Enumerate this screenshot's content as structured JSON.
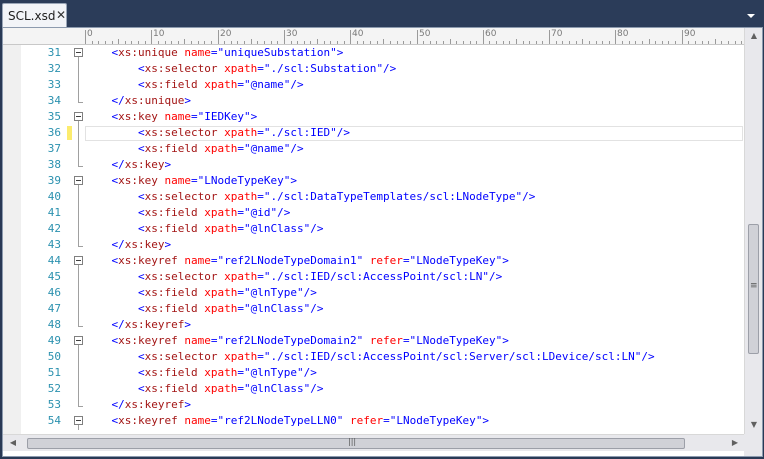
{
  "tab": {
    "title": "SCL.xsd",
    "close_glyph": "✕"
  },
  "ruler": {
    "labels": [
      "0",
      "10",
      "20",
      "30",
      "40",
      "50",
      "60",
      "70",
      "80",
      "90"
    ]
  },
  "scrollbar": {
    "up": "▲",
    "down": "▼",
    "left": "◀",
    "right": "▶",
    "thumb_grip": "≡",
    "hthumb_grip": "|||"
  },
  "editor": {
    "current_line": 36,
    "lines": [
      {
        "num": "31",
        "tokens": [
          [
            "i",
            "    "
          ],
          [
            "b",
            "<"
          ],
          [
            "t",
            "xs:unique"
          ],
          [
            "s",
            " "
          ],
          [
            "a",
            "name"
          ],
          [
            "b",
            "=\""
          ],
          [
            "v",
            "uniqueSubstation"
          ],
          [
            "b",
            "\">"
          ]
        ]
      },
      {
        "num": "32",
        "tokens": [
          [
            "i",
            "        "
          ],
          [
            "b",
            "<"
          ],
          [
            "t",
            "xs:selector"
          ],
          [
            "s",
            " "
          ],
          [
            "a",
            "xpath"
          ],
          [
            "b",
            "=\""
          ],
          [
            "v",
            "./scl:Substation"
          ],
          [
            "b",
            "\"/>"
          ]
        ]
      },
      {
        "num": "33",
        "tokens": [
          [
            "i",
            "        "
          ],
          [
            "b",
            "<"
          ],
          [
            "t",
            "xs:field"
          ],
          [
            "s",
            " "
          ],
          [
            "a",
            "xpath"
          ],
          [
            "b",
            "=\""
          ],
          [
            "v",
            "@name"
          ],
          [
            "b",
            "\"/>"
          ]
        ]
      },
      {
        "num": "34",
        "tokens": [
          [
            "i",
            "    "
          ],
          [
            "b",
            "</"
          ],
          [
            "t",
            "xs:unique"
          ],
          [
            "b",
            ">"
          ]
        ]
      },
      {
        "num": "35",
        "tokens": [
          [
            "i",
            "    "
          ],
          [
            "b",
            "<"
          ],
          [
            "t",
            "xs:key"
          ],
          [
            "s",
            " "
          ],
          [
            "a",
            "name"
          ],
          [
            "b",
            "=\""
          ],
          [
            "v",
            "IEDKey"
          ],
          [
            "b",
            "\">"
          ]
        ]
      },
      {
        "num": "36",
        "tokens": [
          [
            "i",
            "        "
          ],
          [
            "b",
            "<"
          ],
          [
            "t",
            "xs:selector"
          ],
          [
            "s",
            " "
          ],
          [
            "a",
            "xpath"
          ],
          [
            "b",
            "=\""
          ],
          [
            "v",
            "./scl:IED"
          ],
          [
            "b",
            "\"/>"
          ]
        ]
      },
      {
        "num": "37",
        "tokens": [
          [
            "i",
            "        "
          ],
          [
            "b",
            "<"
          ],
          [
            "t",
            "xs:field"
          ],
          [
            "s",
            " "
          ],
          [
            "a",
            "xpath"
          ],
          [
            "b",
            "=\""
          ],
          [
            "v",
            "@name"
          ],
          [
            "b",
            "\"/>"
          ]
        ]
      },
      {
        "num": "38",
        "tokens": [
          [
            "i",
            "    "
          ],
          [
            "b",
            "</"
          ],
          [
            "t",
            "xs:key"
          ],
          [
            "b",
            ">"
          ]
        ]
      },
      {
        "num": "39",
        "tokens": [
          [
            "i",
            "    "
          ],
          [
            "b",
            "<"
          ],
          [
            "t",
            "xs:key"
          ],
          [
            "s",
            " "
          ],
          [
            "a",
            "name"
          ],
          [
            "b",
            "=\""
          ],
          [
            "v",
            "LNodeTypeKey"
          ],
          [
            "b",
            "\">"
          ]
        ]
      },
      {
        "num": "40",
        "tokens": [
          [
            "i",
            "        "
          ],
          [
            "b",
            "<"
          ],
          [
            "t",
            "xs:selector"
          ],
          [
            "s",
            " "
          ],
          [
            "a",
            "xpath"
          ],
          [
            "b",
            "=\""
          ],
          [
            "v",
            "./scl:DataTypeTemplates/scl:LNodeType"
          ],
          [
            "b",
            "\"/>"
          ]
        ]
      },
      {
        "num": "41",
        "tokens": [
          [
            "i",
            "        "
          ],
          [
            "b",
            "<"
          ],
          [
            "t",
            "xs:field"
          ],
          [
            "s",
            " "
          ],
          [
            "a",
            "xpath"
          ],
          [
            "b",
            "=\""
          ],
          [
            "v",
            "@id"
          ],
          [
            "b",
            "\"/>"
          ]
        ]
      },
      {
        "num": "42",
        "tokens": [
          [
            "i",
            "        "
          ],
          [
            "b",
            "<"
          ],
          [
            "t",
            "xs:field"
          ],
          [
            "s",
            " "
          ],
          [
            "a",
            "xpath"
          ],
          [
            "b",
            "=\""
          ],
          [
            "v",
            "@lnClass"
          ],
          [
            "b",
            "\"/>"
          ]
        ]
      },
      {
        "num": "43",
        "tokens": [
          [
            "i",
            "    "
          ],
          [
            "b",
            "</"
          ],
          [
            "t",
            "xs:key"
          ],
          [
            "b",
            ">"
          ]
        ]
      },
      {
        "num": "44",
        "tokens": [
          [
            "i",
            "    "
          ],
          [
            "b",
            "<"
          ],
          [
            "t",
            "xs:keyref"
          ],
          [
            "s",
            " "
          ],
          [
            "a",
            "name"
          ],
          [
            "b",
            "=\""
          ],
          [
            "v",
            "ref2LNodeTypeDomain1"
          ],
          [
            "b",
            "\""
          ],
          [
            "s",
            " "
          ],
          [
            "a",
            "refer"
          ],
          [
            "b",
            "=\""
          ],
          [
            "v",
            "LNodeTypeKey"
          ],
          [
            "b",
            "\">"
          ]
        ]
      },
      {
        "num": "45",
        "tokens": [
          [
            "i",
            "        "
          ],
          [
            "b",
            "<"
          ],
          [
            "t",
            "xs:selector"
          ],
          [
            "s",
            " "
          ],
          [
            "a",
            "xpath"
          ],
          [
            "b",
            "=\""
          ],
          [
            "v",
            "./scl:IED/scl:AccessPoint/scl:LN"
          ],
          [
            "b",
            "\"/>"
          ]
        ]
      },
      {
        "num": "46",
        "tokens": [
          [
            "i",
            "        "
          ],
          [
            "b",
            "<"
          ],
          [
            "t",
            "xs:field"
          ],
          [
            "s",
            " "
          ],
          [
            "a",
            "xpath"
          ],
          [
            "b",
            "=\""
          ],
          [
            "v",
            "@lnType"
          ],
          [
            "b",
            "\"/>"
          ]
        ]
      },
      {
        "num": "47",
        "tokens": [
          [
            "i",
            "        "
          ],
          [
            "b",
            "<"
          ],
          [
            "t",
            "xs:field"
          ],
          [
            "s",
            " "
          ],
          [
            "a",
            "xpath"
          ],
          [
            "b",
            "=\""
          ],
          [
            "v",
            "@lnClass"
          ],
          [
            "b",
            "\"/>"
          ]
        ]
      },
      {
        "num": "48",
        "tokens": [
          [
            "i",
            "    "
          ],
          [
            "b",
            "</"
          ],
          [
            "t",
            "xs:keyref"
          ],
          [
            "b",
            ">"
          ]
        ]
      },
      {
        "num": "49",
        "tokens": [
          [
            "i",
            "    "
          ],
          [
            "b",
            "<"
          ],
          [
            "t",
            "xs:keyref"
          ],
          [
            "s",
            " "
          ],
          [
            "a",
            "name"
          ],
          [
            "b",
            "=\""
          ],
          [
            "v",
            "ref2LNodeTypeDomain2"
          ],
          [
            "b",
            "\""
          ],
          [
            "s",
            " "
          ],
          [
            "a",
            "refer"
          ],
          [
            "b",
            "=\""
          ],
          [
            "v",
            "LNodeTypeKey"
          ],
          [
            "b",
            "\">"
          ]
        ]
      },
      {
        "num": "50",
        "tokens": [
          [
            "i",
            "        "
          ],
          [
            "b",
            "<"
          ],
          [
            "t",
            "xs:selector"
          ],
          [
            "s",
            " "
          ],
          [
            "a",
            "xpath"
          ],
          [
            "b",
            "=\""
          ],
          [
            "v",
            "./scl:IED/scl:AccessPoint/scl:Server/scl:LDevice/scl:LN"
          ],
          [
            "b",
            "\"/>"
          ]
        ]
      },
      {
        "num": "51",
        "tokens": [
          [
            "i",
            "        "
          ],
          [
            "b",
            "<"
          ],
          [
            "t",
            "xs:field"
          ],
          [
            "s",
            " "
          ],
          [
            "a",
            "xpath"
          ],
          [
            "b",
            "=\""
          ],
          [
            "v",
            "@lnType"
          ],
          [
            "b",
            "\"/>"
          ]
        ]
      },
      {
        "num": "52",
        "tokens": [
          [
            "i",
            "        "
          ],
          [
            "b",
            "<"
          ],
          [
            "t",
            "xs:field"
          ],
          [
            "s",
            " "
          ],
          [
            "a",
            "xpath"
          ],
          [
            "b",
            "=\""
          ],
          [
            "v",
            "@lnClass"
          ],
          [
            "b",
            "\"/>"
          ]
        ]
      },
      {
        "num": "53",
        "tokens": [
          [
            "i",
            "    "
          ],
          [
            "b",
            "</"
          ],
          [
            "t",
            "xs:keyref"
          ],
          [
            "b",
            ">"
          ]
        ]
      },
      {
        "num": "54",
        "tokens": [
          [
            "i",
            "    "
          ],
          [
            "b",
            "<"
          ],
          [
            "t",
            "xs:keyref"
          ],
          [
            "s",
            " "
          ],
          [
            "a",
            "name"
          ],
          [
            "b",
            "=\""
          ],
          [
            "v",
            "ref2LNodeTypeLLN0"
          ],
          [
            "b",
            "\""
          ],
          [
            "s",
            " "
          ],
          [
            "a",
            "refer"
          ],
          [
            "b",
            "=\""
          ],
          [
            "v",
            "LNodeTypeKey"
          ],
          [
            "b",
            "\">"
          ]
        ]
      }
    ]
  },
  "colors": {
    "bracket": "#0000ff",
    "tag": "#a31515",
    "attribute": "#ff0000",
    "value": "#0000ff",
    "line_number": "#2b91af",
    "change_marker": "#fcec6e",
    "window_chrome": "#293955"
  }
}
